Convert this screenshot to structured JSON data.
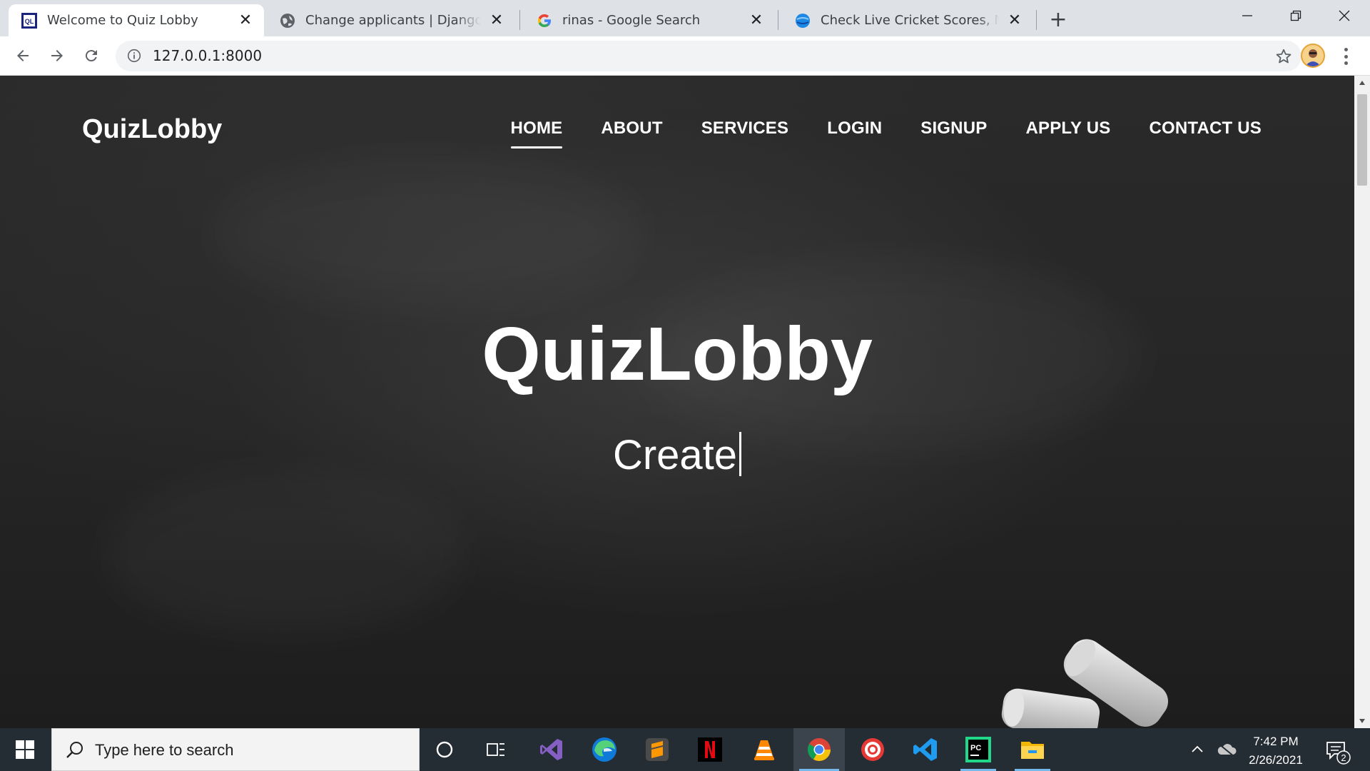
{
  "browser": {
    "tabs": [
      {
        "title": "Welcome to Quiz Lobby",
        "favicon": "quizlobby-favicon",
        "active": true
      },
      {
        "title": "Change applicants | Django site admin",
        "favicon": "globe-icon",
        "active": false
      },
      {
        "title": "rinas - Google Search",
        "favicon": "google-icon",
        "active": false
      },
      {
        "title": "Check Live Cricket Scores, Match Schedule",
        "favicon": "cricket-icon",
        "active": false
      }
    ],
    "new_tab_label": "+",
    "url": "127.0.0.1:8000"
  },
  "page": {
    "brand": "QuizLobby",
    "nav": [
      {
        "label": "HOME",
        "active": true
      },
      {
        "label": "ABOUT",
        "active": false
      },
      {
        "label": "SERVICES",
        "active": false
      },
      {
        "label": "LOGIN",
        "active": false
      },
      {
        "label": "SIGNUP",
        "active": false
      },
      {
        "label": "APPLY US",
        "active": false
      },
      {
        "label": "CONTACT US",
        "active": false
      }
    ],
    "hero_title": "QuizLobby",
    "hero_typed": "Create"
  },
  "taskbar": {
    "search_placeholder": "Type here to search",
    "apps": [
      "cortana-icon",
      "task-view-icon",
      "visual-studio-icon",
      "edge-icon",
      "sublime-text-icon",
      "netflix-icon",
      "vlc-icon",
      "chrome-icon",
      "chrome-canary-icon",
      "vscode-icon",
      "pycharm-icon",
      "file-explorer-icon"
    ],
    "time": "7:42 PM",
    "date": "2/26/2021",
    "notification_count": "2"
  },
  "colors": {
    "tabstrip": "#dee1e6",
    "chalkboard": "#262626",
    "taskbar": "#242c34",
    "accent": "#76b9ed"
  }
}
